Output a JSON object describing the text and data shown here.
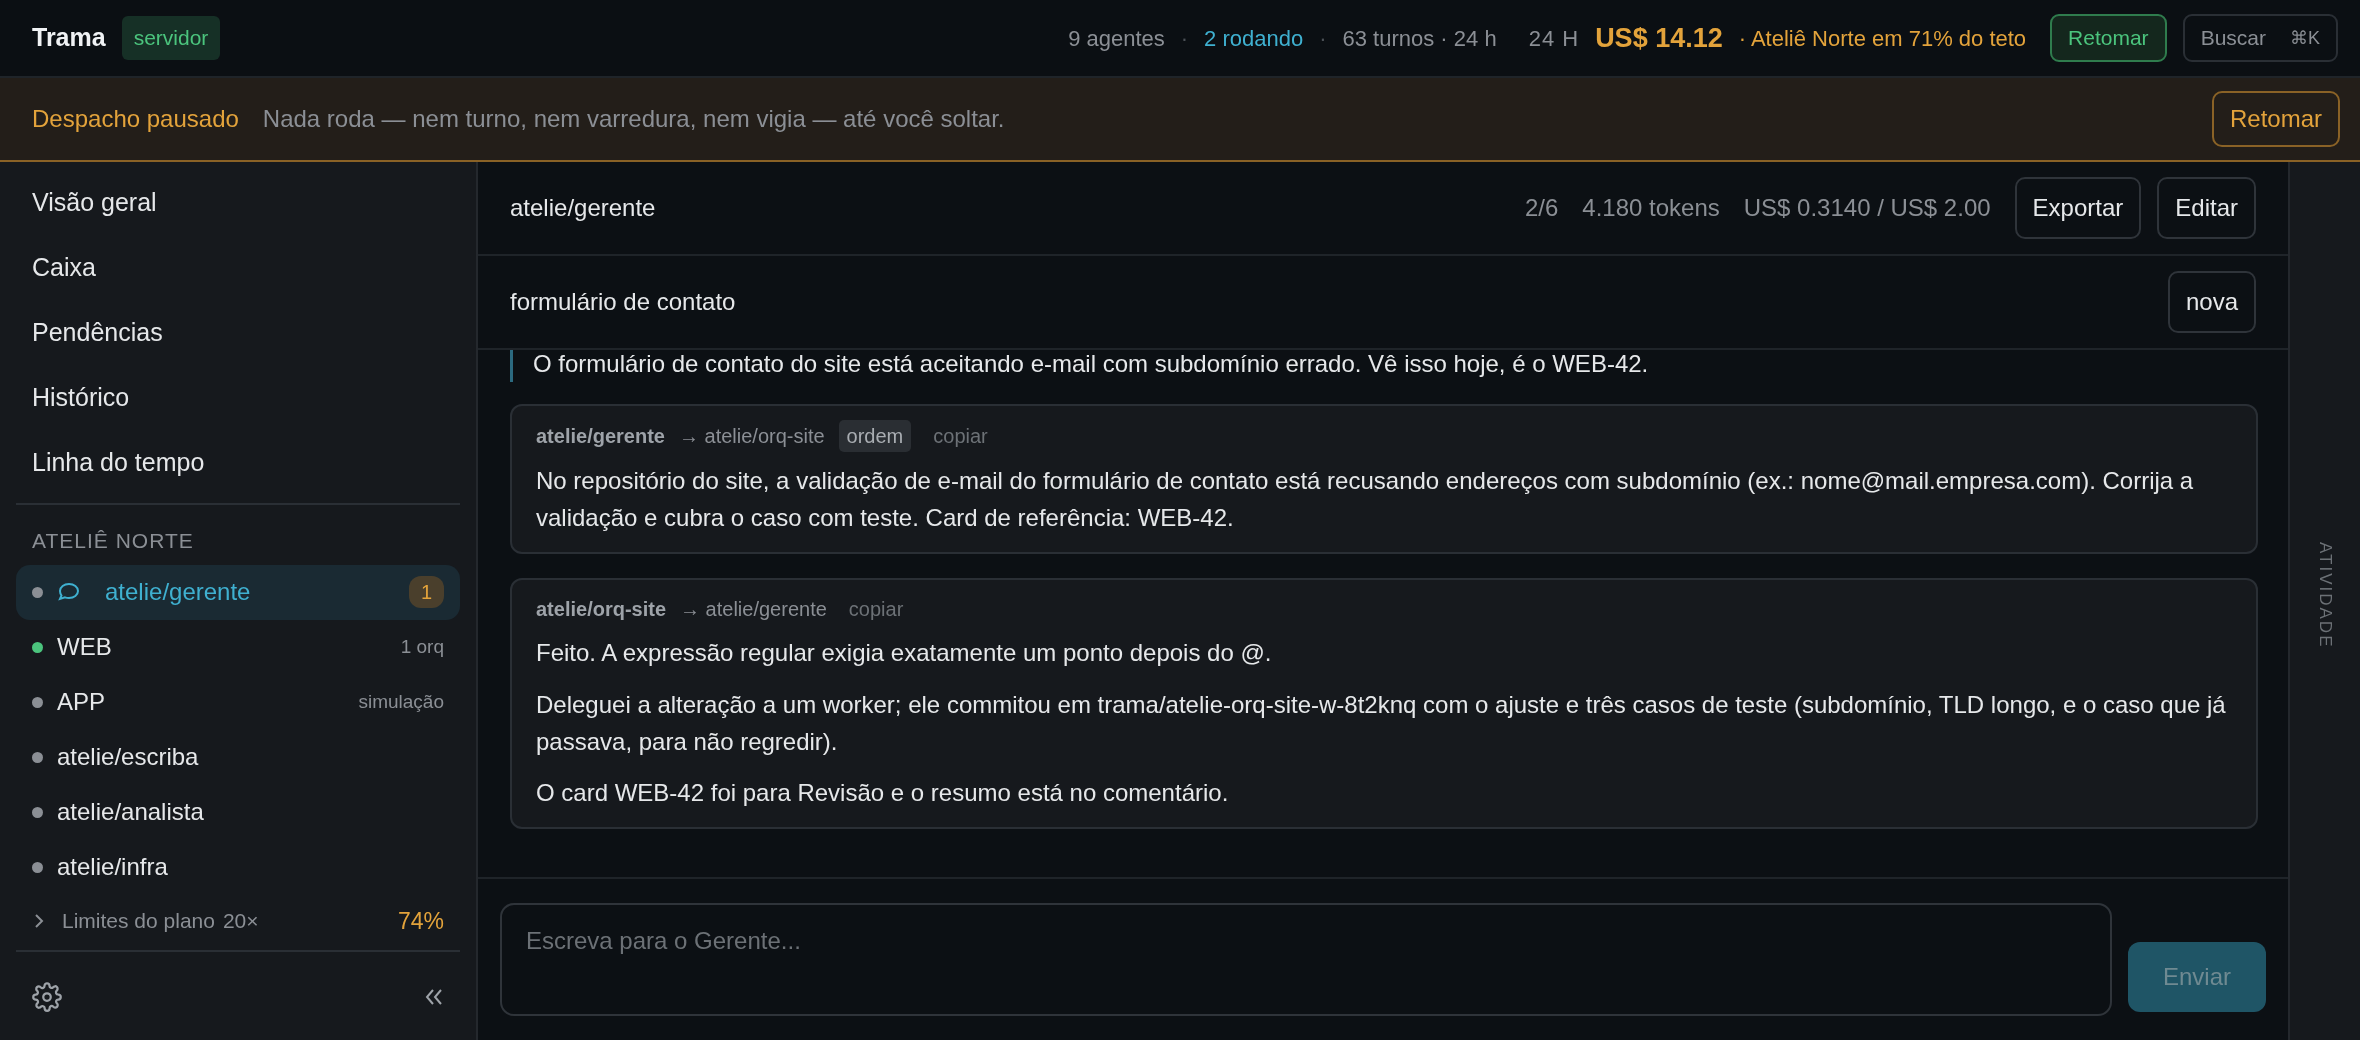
{
  "topbar": {
    "brand": "Trama",
    "env_badge": "servidor",
    "stats": [
      {
        "text": "9 agentes",
        "kind": "muted"
      },
      {
        "text": "·",
        "kind": "separator"
      },
      {
        "text": "2 rodando",
        "kind": "info"
      },
      {
        "text": "·",
        "kind": "separator"
      },
      {
        "text": "63 turnos · 24 h",
        "kind": "muted"
      }
    ],
    "spend": {
      "period": "24 H",
      "amount": "US$ 14.12",
      "note": "· Ateliê Norte em 71% do teto"
    },
    "resume_button": "Retomar",
    "search": {
      "label": "Buscar",
      "shortcut": "⌘K"
    }
  },
  "banner": {
    "title": "Despacho pausado",
    "message": "Nada roda — nem turno, nem varredura, nem vigia — até você soltar.",
    "button": "Retomar"
  },
  "sidebar": {
    "nav": [
      {
        "label": "Visão geral",
        "selected": false
      },
      {
        "label": "Caixa",
        "selected": false
      },
      {
        "label": "Pendências",
        "selected": false
      },
      {
        "label": "Histórico",
        "selected": false
      },
      {
        "label": "Linha do tempo",
        "selected": false
      }
    ],
    "section": "ATELIÊ NORTE",
    "agents": [
      {
        "name": "atelie/gerente",
        "color": "#8b8f95",
        "selected": true,
        "kind": "chat",
        "badge": "1"
      },
      {
        "name": "WEB",
        "color": "#4bc47d",
        "selected": false,
        "kind": "project",
        "meta": "1 orq"
      },
      {
        "name": "APP",
        "color": "#8b8f95",
        "selected": false,
        "kind": "project",
        "meta": "simulação"
      },
      {
        "name": "atelie/escriba",
        "color": "#8b8f95",
        "selected": false,
        "kind": "agent"
      },
      {
        "name": "atelie/analista",
        "color": "#8b8f95",
        "selected": false,
        "kind": "agent"
      },
      {
        "name": "atelie/infra",
        "color": "#8b8f95",
        "selected": false,
        "kind": "agent"
      }
    ],
    "plan_limits": {
      "label": "Limites do plano",
      "multiplier": "20×",
      "percent": "74%",
      "expanded": false
    }
  },
  "main": {
    "title": "atelie/gerente",
    "stats": [
      "2/6",
      "4.180 tokens",
      "US$ 0.3140 / US$ 2.00"
    ],
    "buttons": [
      "Exportar",
      "Editar"
    ],
    "thread": {
      "title": "formulário de contato",
      "button": "nova"
    },
    "messages": [
      {
        "kind": "quote",
        "paragraphs": [
          "O formulário de contato do site está aceitando e-mail com subdomínio errado. Vê isso hoje, é o WEB-42."
        ]
      },
      {
        "kind": "card",
        "from": "atelie/gerente",
        "to": "→ atelie/orq-site",
        "tag": "ordem",
        "action": "copiar",
        "paragraphs": [
          "No repositório do site, a validação de e-mail do formulário de contato está recusando endereços com subdomínio (ex.: nome@mail.empresa.com). Corrija a validação e cubra o caso com teste. Card de referência: WEB-42."
        ]
      },
      {
        "kind": "card",
        "from": "atelie/orq-site",
        "to": "→ atelie/gerente",
        "action": "copiar",
        "paragraphs": [
          "Feito. A expressão regular exigia exatamente um ponto depois do @.",
          "Deleguei a alteração a um worker; ele commitou em trama/atelie-orq-site-w-8t2knq com o ajuste e três casos de teste (subdomínio, TLD longo, e o caso que já passava, para não regredir).",
          "O card WEB-42 foi para Revisão e o resumo está no comentário."
        ]
      }
    ],
    "composer": {
      "placeholder": "Escreva para o Gerente...",
      "send": "Enviar",
      "disabled": true
    }
  },
  "rail": {
    "label": "ATIVIDADE"
  }
}
